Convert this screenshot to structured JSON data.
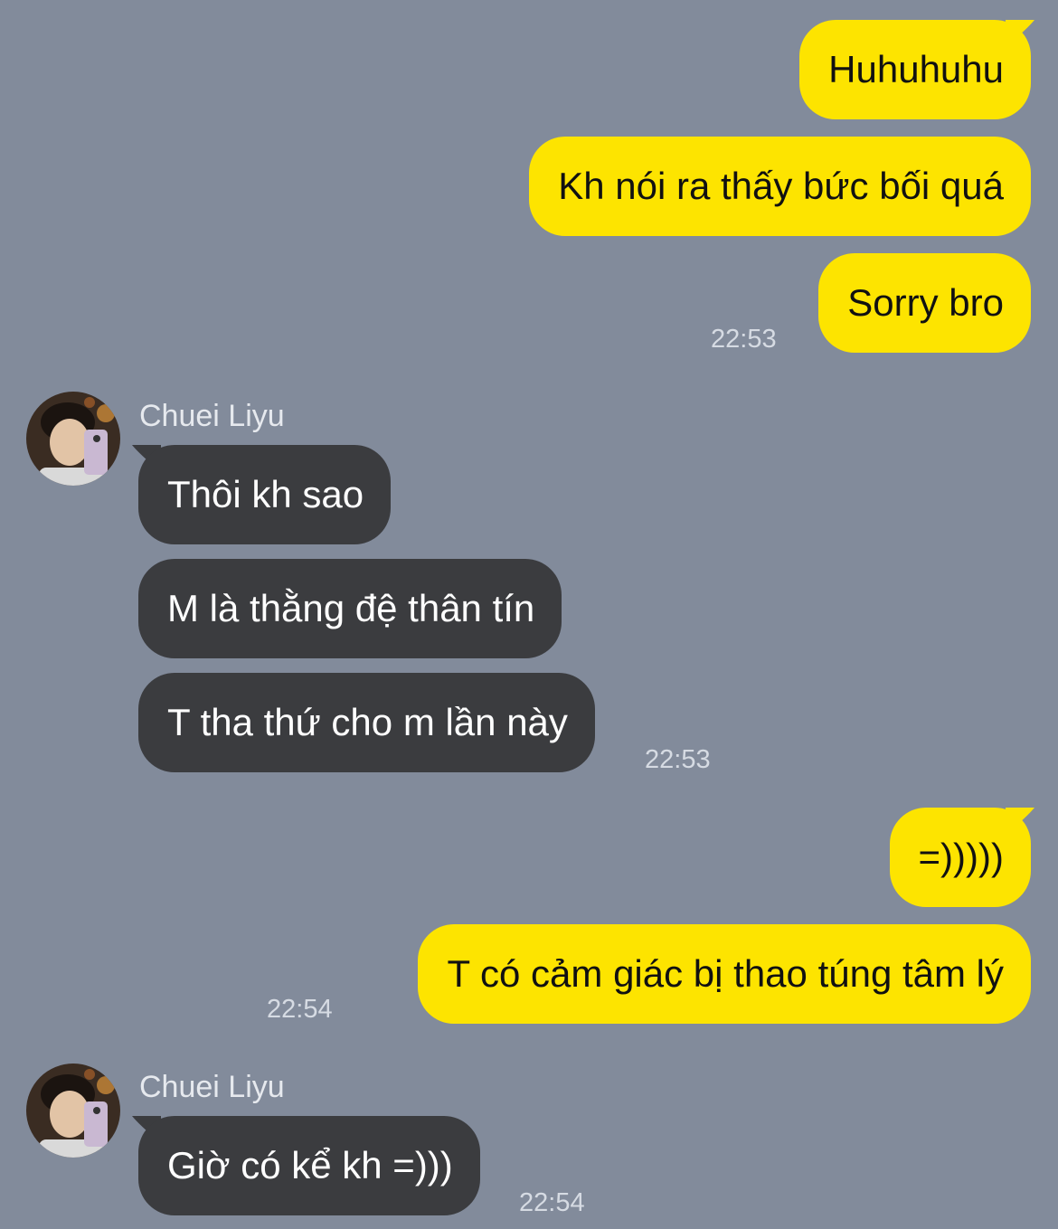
{
  "colors": {
    "background": "#828b9b",
    "outgoing_bubble": "#fde400",
    "incoming_bubble": "#3b3c3f",
    "timestamp": "#d6dbe3"
  },
  "messages": [
    {
      "direction": "out",
      "text": "Huhuhuhu"
    },
    {
      "direction": "out",
      "text": "Kh nói ra thấy bức bối quá"
    },
    {
      "direction": "out",
      "text": "Sorry bro",
      "time": "22:53"
    },
    {
      "direction": "in",
      "sender": "Chuei Liyu",
      "avatar": "contact-avatar-photo",
      "text": "Thôi kh sao"
    },
    {
      "direction": "in",
      "text": "M là thằng đệ thân tín"
    },
    {
      "direction": "in",
      "text": "T tha thứ cho m lần này",
      "time": "22:53"
    },
    {
      "direction": "out",
      "text": "=)))))"
    },
    {
      "direction": "out",
      "text": "T có cảm giác bị thao túng tâm lý",
      "time": "22:54"
    },
    {
      "direction": "in",
      "sender": "Chuei Liyu",
      "avatar": "contact-avatar-photo",
      "text": "Giờ có kể kh =)))",
      "time": "22:54"
    }
  ]
}
